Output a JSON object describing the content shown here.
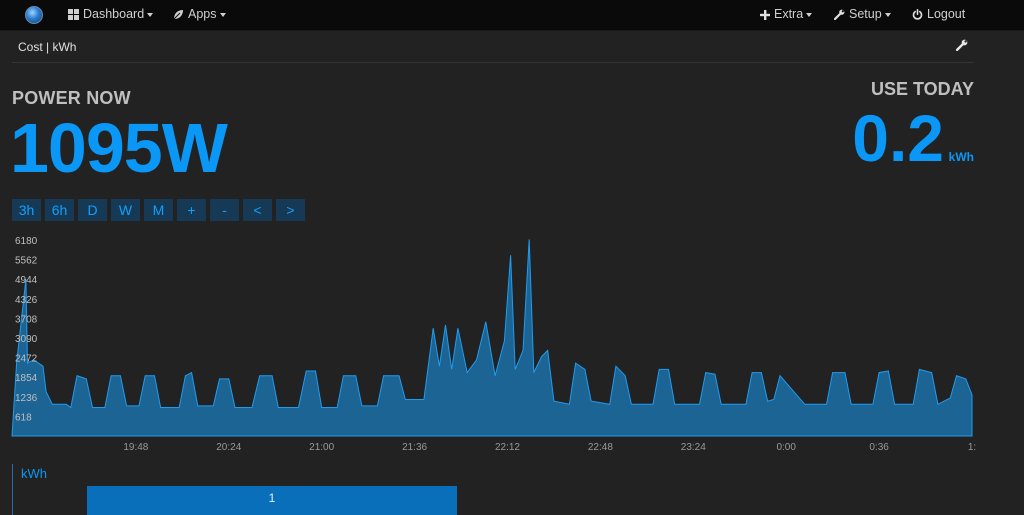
{
  "nav": {
    "dashboard": "Dashboard",
    "apps": "Apps",
    "extra": "Extra",
    "setup": "Setup",
    "logout": "Logout"
  },
  "subbar": {
    "title": "Cost | kWh"
  },
  "power": {
    "label": "POWER NOW",
    "value": "1095W"
  },
  "use": {
    "label": "USE TODAY",
    "value": "0.2",
    "unit": "kWh"
  },
  "zoom_buttons": [
    "3h",
    "6h",
    "D",
    "W",
    "M",
    "+",
    "-",
    "<",
    ">"
  ],
  "colors": {
    "accent": "#0a97f5",
    "background": "#222222",
    "area_fill": "#1c6494",
    "navbar": "#0a0a0a"
  },
  "chart_data": {
    "type": "area",
    "ylim": [
      0,
      6180
    ],
    "y_ticks": [
      "618",
      "1236",
      "1854",
      "2472",
      "3090",
      "3708",
      "4326",
      "4944",
      "5562",
      "6180"
    ],
    "x_ticks": [
      {
        "label": "19:48",
        "t": 19.8
      },
      {
        "label": "20:24",
        "t": 20.4
      },
      {
        "label": "21:00",
        "t": 21.0
      },
      {
        "label": "21:36",
        "t": 21.6
      },
      {
        "label": "22:12",
        "t": 22.2
      },
      {
        "label": "22:48",
        "t": 22.8
      },
      {
        "label": "23:24",
        "t": 23.4
      },
      {
        "label": "0:00",
        "t": 24.0
      },
      {
        "label": "0:36",
        "t": 24.6
      },
      {
        "label": "1:",
        "t": 25.2
      }
    ],
    "xlim": [
      19.0,
      25.2
    ],
    "series": [
      {
        "points": [
          [
            19.0,
            0
          ],
          [
            19.03,
            2300
          ],
          [
            19.09,
            4944
          ],
          [
            19.1,
            2300
          ],
          [
            19.14,
            2400
          ],
          [
            19.2,
            2200
          ],
          [
            19.22,
            1400
          ],
          [
            19.26,
            1000
          ],
          [
            19.35,
            1000
          ],
          [
            19.38,
            900
          ],
          [
            19.42,
            1900
          ],
          [
            19.48,
            1800
          ],
          [
            19.52,
            900
          ],
          [
            19.6,
            900
          ],
          [
            19.64,
            1900
          ],
          [
            19.7,
            1900
          ],
          [
            19.74,
            950
          ],
          [
            19.82,
            950
          ],
          [
            19.86,
            1900
          ],
          [
            19.92,
            1900
          ],
          [
            19.96,
            900
          ],
          [
            20.08,
            900
          ],
          [
            20.12,
            1900
          ],
          [
            20.16,
            2000
          ],
          [
            20.2,
            950
          ],
          [
            20.3,
            950
          ],
          [
            20.34,
            1800
          ],
          [
            20.4,
            1800
          ],
          [
            20.44,
            900
          ],
          [
            20.55,
            900
          ],
          [
            20.6,
            1900
          ],
          [
            20.68,
            1900
          ],
          [
            20.72,
            900
          ],
          [
            20.85,
            900
          ],
          [
            20.9,
            2050
          ],
          [
            20.96,
            2050
          ],
          [
            21.0,
            900
          ],
          [
            21.1,
            900
          ],
          [
            21.14,
            1900
          ],
          [
            21.22,
            1900
          ],
          [
            21.26,
            950
          ],
          [
            21.36,
            950
          ],
          [
            21.4,
            1900
          ],
          [
            21.5,
            1900
          ],
          [
            21.54,
            1150
          ],
          [
            21.66,
            1150
          ],
          [
            21.72,
            3400
          ],
          [
            21.76,
            2200
          ],
          [
            21.8,
            3500
          ],
          [
            21.84,
            2100
          ],
          [
            21.88,
            3400
          ],
          [
            21.94,
            2000
          ],
          [
            22.0,
            2400
          ],
          [
            22.06,
            3600
          ],
          [
            22.12,
            1900
          ],
          [
            22.18,
            3000
          ],
          [
            22.22,
            5700
          ],
          [
            22.25,
            2100
          ],
          [
            22.3,
            2700
          ],
          [
            22.34,
            6200
          ],
          [
            22.37,
            2000
          ],
          [
            22.42,
            2500
          ],
          [
            22.46,
            2700
          ],
          [
            22.5,
            1100
          ],
          [
            22.6,
            1000
          ],
          [
            22.64,
            2300
          ],
          [
            22.7,
            2100
          ],
          [
            22.74,
            1100
          ],
          [
            22.86,
            1000
          ],
          [
            22.9,
            2200
          ],
          [
            22.96,
            1900
          ],
          [
            23.0,
            1000
          ],
          [
            23.14,
            1000
          ],
          [
            23.18,
            2100
          ],
          [
            23.24,
            2100
          ],
          [
            23.28,
            1000
          ],
          [
            23.44,
            1000
          ],
          [
            23.48,
            2000
          ],
          [
            23.54,
            1950
          ],
          [
            23.58,
            1000
          ],
          [
            23.74,
            1000
          ],
          [
            23.78,
            2000
          ],
          [
            23.84,
            2000
          ],
          [
            23.88,
            1100
          ],
          [
            23.92,
            1150
          ],
          [
            23.96,
            1900
          ],
          [
            24.12,
            1000
          ],
          [
            24.26,
            1000
          ],
          [
            24.3,
            2000
          ],
          [
            24.38,
            2000
          ],
          [
            24.42,
            1000
          ],
          [
            24.56,
            1000
          ],
          [
            24.6,
            2000
          ],
          [
            24.66,
            2050
          ],
          [
            24.7,
            1000
          ],
          [
            24.82,
            1000
          ],
          [
            24.86,
            2100
          ],
          [
            24.94,
            2000
          ],
          [
            24.98,
            1000
          ],
          [
            25.06,
            1200
          ],
          [
            25.1,
            1900
          ],
          [
            25.16,
            1800
          ],
          [
            25.2,
            1300
          ],
          [
            25.2,
            0
          ]
        ]
      }
    ]
  },
  "kwh_panel": {
    "label": "kWh",
    "bar_value": "1"
  }
}
